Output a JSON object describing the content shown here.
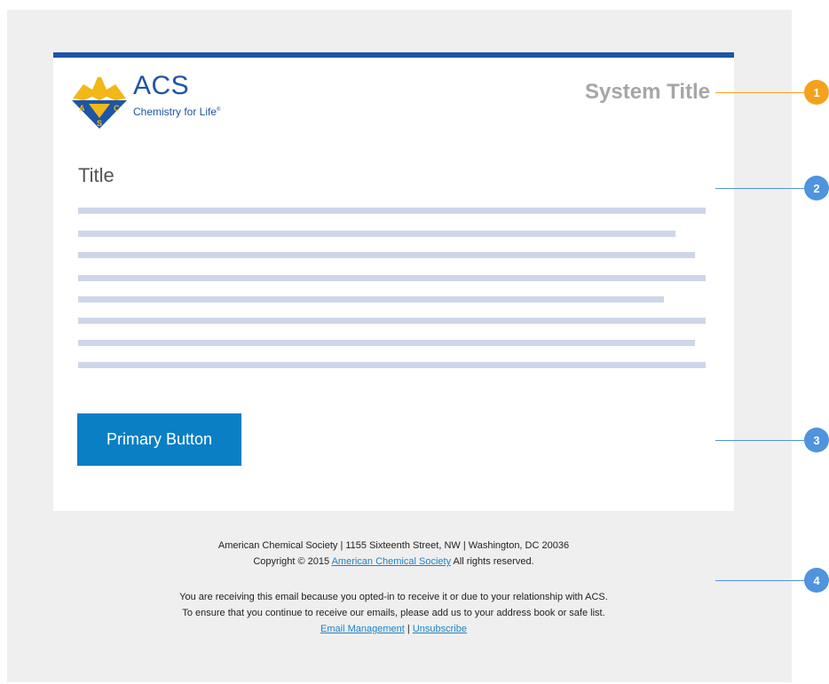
{
  "colors": {
    "accent_blue": "#1e55a5",
    "button": "#0a7fc4",
    "callout_orange": "#f4a21e",
    "callout_blue": "#4f94dc",
    "placeholder_line": "#cfd6e9"
  },
  "header": {
    "logo_text": "ACS",
    "logo_tagline": "Chemistry for Life",
    "logo_icon": "acs-eagle-shield-icon",
    "system_title": "System Title"
  },
  "content": {
    "title": "Title",
    "primary_button": "Primary Button"
  },
  "footer": {
    "address": "American Chemical Society | 1155 Sixteenth Street, NW | Washington, DC 20036",
    "copyright_prefix": "Copyright © 2015",
    "copyright_link": "American Chemical Society",
    "copyright_suffix": "All rights reserved.",
    "notice_line1": "You are receiving this email because you opted-in to receive it or due to your relationship with ACS.",
    "notice_line2": "To ensure that you continue to receive our emails, please add us to your address book or safe list.",
    "email_management": "Email Management",
    "separator": "|",
    "unsubscribe": "Unsubscribe"
  },
  "callouts": [
    "1",
    "2",
    "3",
    "4"
  ]
}
